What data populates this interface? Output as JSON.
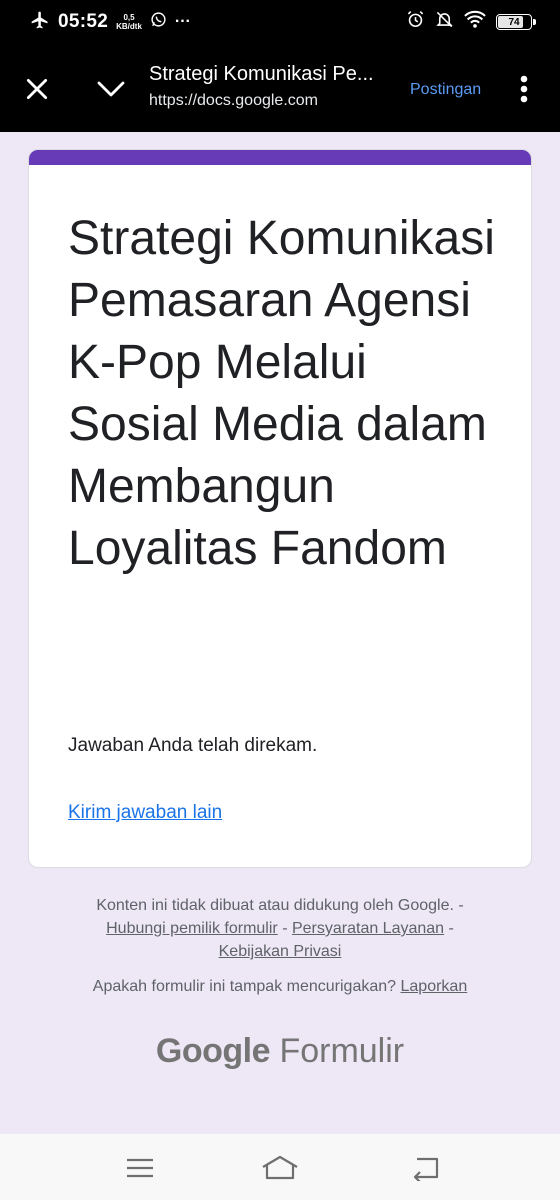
{
  "status_bar": {
    "time": "05:52",
    "speed_value": "0,5",
    "speed_unit": "KB/dtk",
    "more": "···",
    "battery": "74",
    "icons": [
      "airplane-icon",
      "whatsapp-icon",
      "alarm-icon",
      "mute-icon",
      "wifi-icon",
      "battery-icon"
    ]
  },
  "toolbar": {
    "title": "Strategi Komunikasi Pe...",
    "url": "https://docs.google.com",
    "post_label": "Postingan",
    "icons": [
      "close-icon",
      "chevron-down-icon",
      "more-vert-icon"
    ]
  },
  "form": {
    "title": "Strategi Komunikasi Pemasaran Agensi K-Pop Melalui Sosial Media dalam Membangun Loyalitas Fandom",
    "confirmation": "Jawaban Anda telah direkam.",
    "resubmit_link": "Kirim jawaban lain",
    "accent_color": "#673ab7"
  },
  "footer": {
    "disclaimer": "Konten ini tidak dibuat atau didukung oleh Google. -",
    "contact_link": "Hubungi pemilik formulir",
    "sep1": " - ",
    "terms_link": "Persyaratan Layanan",
    "sep2": " -",
    "privacy_link": "Kebijakan Privasi",
    "suspicious_text": "Apakah formulir ini tampak mencurigakan?",
    "report_link": "Laporkan",
    "brand_google": "Google",
    "brand_product": "Formulir"
  },
  "nav_bar": {
    "icons": [
      "menu-icon",
      "home-icon",
      "back-icon"
    ]
  }
}
